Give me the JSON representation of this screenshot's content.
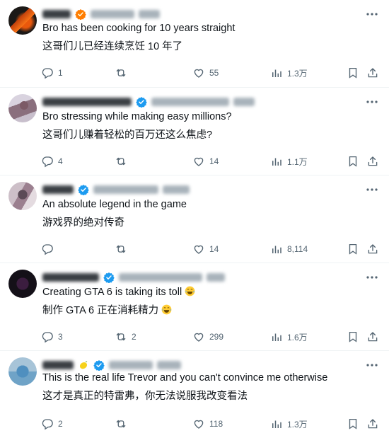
{
  "colors": {
    "verified": "#1d9bf0",
    "icon": "#536471",
    "text": "#0f1419",
    "divider": "#eff3f4"
  },
  "icons": [
    "more-icon",
    "verified-icon",
    "reply-icon",
    "repost-icon",
    "like-icon",
    "views-icon",
    "bookmark-icon",
    "share-icon",
    "lemon-icon",
    "joy-emoji"
  ],
  "posts": [
    {
      "text_en": "Bro has been cooking for 10 years straight",
      "text_zh": "这哥们儿已经连续烹饪 10 年了",
      "replies": "1",
      "reposts": "",
      "likes": "55",
      "views": "1.3万"
    },
    {
      "text_en": "Bro stressing while making easy millions?",
      "text_zh": "这哥们儿赚着轻松的百万还这么焦虑?",
      "replies": "4",
      "reposts": "",
      "likes": "14",
      "views": "1.1万"
    },
    {
      "text_en": "An absolute legend in the game",
      "text_zh": "游戏界的绝对传奇",
      "replies": "",
      "reposts": "",
      "likes": "14",
      "views": "8,114"
    },
    {
      "text_en": "Creating GTA 6 is taking its toll",
      "text_zh": "制作 GTA 6 正在消耗精力",
      "replies": "3",
      "reposts": "2",
      "likes": "299",
      "views": "1.6万"
    },
    {
      "text_en": "This is the real life Trevor and you can't convince me otherwise",
      "text_zh": "这才是真正的特雷弗，你无法说服我改变看法",
      "replies": "2",
      "reposts": "",
      "likes": "118",
      "views": "1.3万"
    }
  ]
}
